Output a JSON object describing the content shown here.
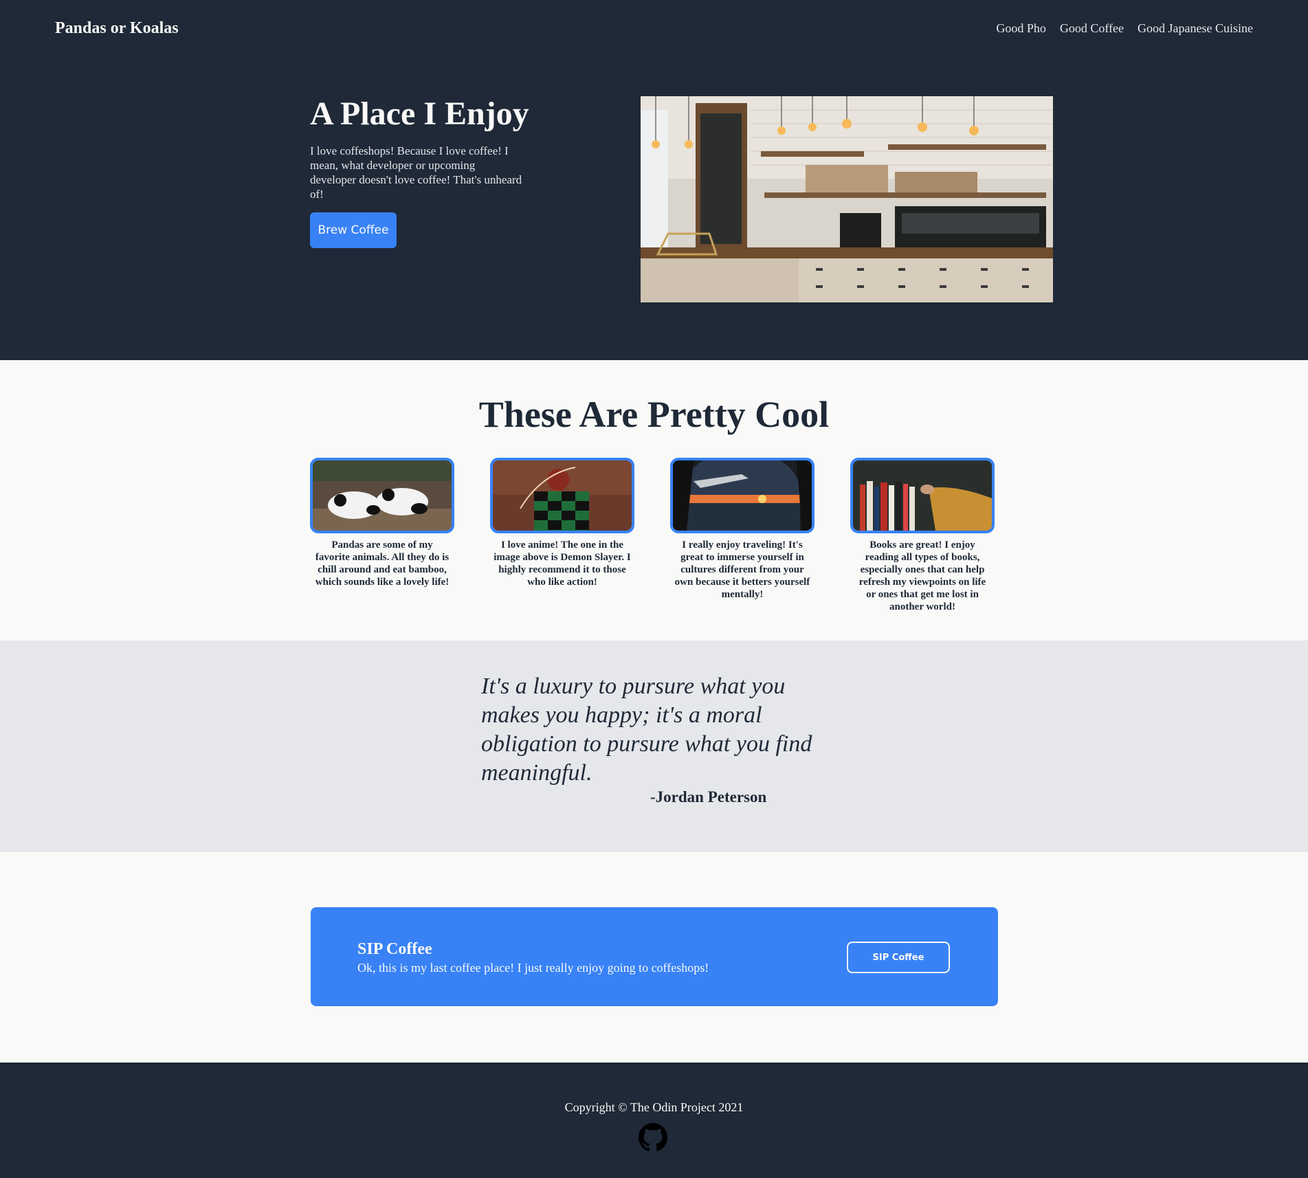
{
  "header": {
    "logo": "Pandas or Koalas",
    "nav": [
      "Good Pho",
      "Good Coffee",
      "Good Japanese Cuisine"
    ]
  },
  "hero": {
    "title": "A Place I Enjoy",
    "description": "I love coffeshops! Because I love coffee! I mean, what developer or upcoming developer doesn't love coffee! That's unheard of!",
    "button_label": "Brew Coffee",
    "image_alt": "coffee-shop-photo"
  },
  "cool": {
    "title": "These Are Pretty Cool",
    "cards": [
      {
        "text": "Pandas are some of my favorite animals. All they do is chill around and eat bamboo, which sounds like a lovely life!",
        "image": "pandas-photo"
      },
      {
        "text": "I love anime! The one in the image above is Demon Slayer. I highly recommend it to those who like action!",
        "image": "anime-photo"
      },
      {
        "text": "I really enjoy traveling! It's great to immerse yourself in cultures different from your own because it betters yourself mentally!",
        "image": "airplane-window-photo"
      },
      {
        "text": "Books are great! I enjoy reading all types of books, especially ones that can help refresh my viewpoints on life or ones that get me lost in another world!",
        "image": "books-photo"
      }
    ]
  },
  "quote": {
    "text": "It's a luxury to pursure what you makes you happy; it's a moral obligation to pursure what you find meaningful.",
    "author": "-Jordan Peterson"
  },
  "cta": {
    "title": "SIP Coffee",
    "description": "Ok, this is my last coffee place! I just really enjoy going to coffeshops!",
    "button_label": "SIP Coffee"
  },
  "footer": {
    "copyright": "Copyright © The Odin Project 2021",
    "icon": "github-icon"
  },
  "colors": {
    "dark": "#1f2937",
    "accent": "#3882f6",
    "light": "#f9faf8",
    "gray": "#e5e7eb"
  }
}
